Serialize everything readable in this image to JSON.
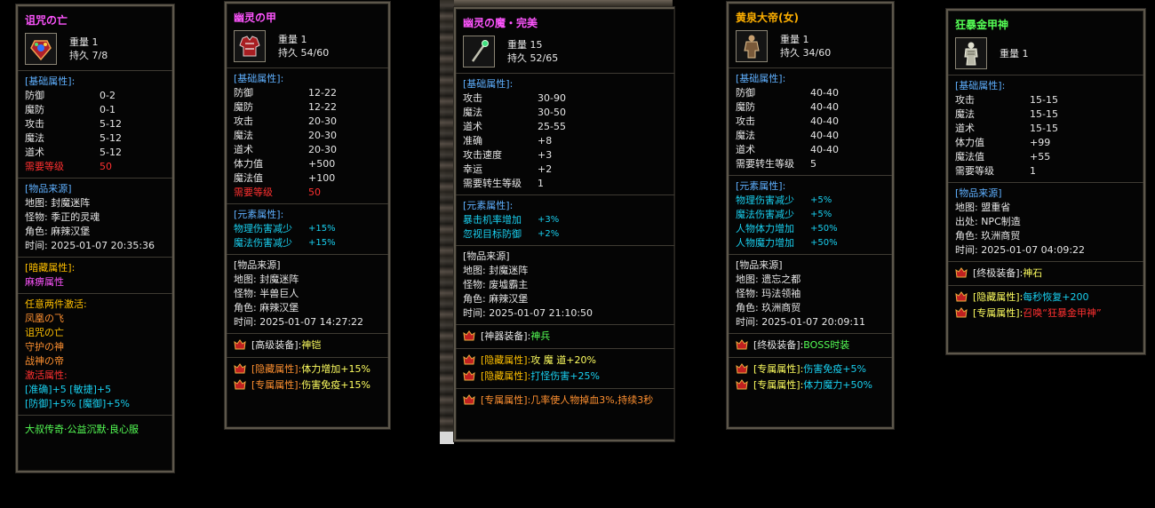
{
  "panels": [
    {
      "title": "诅咒の亡",
      "weight": "重量 1",
      "durability": "持久 7/8",
      "base_label": "[基础属性]:",
      "base": [
        {
          "k": "防御",
          "v": "0-2"
        },
        {
          "k": "魔防",
          "v": "0-1"
        },
        {
          "k": "攻击",
          "v": "5-12"
        },
        {
          "k": "魔法",
          "v": "5-12"
        },
        {
          "k": "道术",
          "v": "5-12"
        }
      ],
      "req": {
        "k": "需要等级",
        "v": "50"
      },
      "source_label": "[物品来源]",
      "source": [
        "地图: 封魔迷阵",
        "怪物: 季正的灵魂",
        "角色: 麻辣汉堡",
        "时间: 2025-01-07 20:35:36"
      ],
      "hidden_label": "[暗藏属性]:",
      "hidden_value": "麻痹属性",
      "set_title": "任意两件激活:",
      "set_items": [
        "凤凰の飞",
        "诅咒の亡",
        "守护の神",
        "战神の帝"
      ],
      "set_active": "激活属性:",
      "set_bonus_1": "[准确]+5  [敏捷]+5",
      "set_bonus_2": "[防御]+5%  [魔御]+5%",
      "footer": "大叔传奇·公益沉默·良心服"
    },
    {
      "title": "幽灵の甲",
      "weight": "重量 1",
      "durability": "持久 54/60",
      "base_label": "[基础属性]:",
      "base": [
        {
          "k": "防御",
          "v": "12-22"
        },
        {
          "k": "魔防",
          "v": "12-22"
        },
        {
          "k": "攻击",
          "v": "20-30"
        },
        {
          "k": "魔法",
          "v": "20-30"
        },
        {
          "k": "道术",
          "v": "20-30"
        },
        {
          "k": "体力值",
          "v": "+500"
        },
        {
          "k": "魔法值",
          "v": "+100"
        }
      ],
      "req": {
        "k": "需要等级",
        "v": "50"
      },
      "elem_label": "[元素属性]:",
      "elem": [
        {
          "k": "物理伤害减少",
          "v": "+15%"
        },
        {
          "k": "魔法伤害减少",
          "v": "+15%"
        }
      ],
      "source_label": "[物品来源]",
      "source": [
        "地图: 封魔迷阵",
        "怪物: 半兽巨人",
        "角色: 麻辣汉堡",
        "时间: 2025-01-07 14:27:22"
      ],
      "equip_label": "[高级装备]:",
      "equip_value": "神铠",
      "hidden_label": "[隐藏属性]:",
      "hidden_value": "体力增加+15%",
      "special_label": "[专属属性]:",
      "special_value": "伤害免疫+15%"
    },
    {
      "title": "幽灵の魔・完美",
      "weight": "重量 15",
      "durability": "持久 52/65",
      "base_label": "[基础属性]:",
      "base": [
        {
          "k": "攻击",
          "v": "30-90"
        },
        {
          "k": "魔法",
          "v": "30-50"
        },
        {
          "k": "道术",
          "v": "25-55"
        },
        {
          "k": "准确",
          "v": "+8"
        },
        {
          "k": "攻击速度",
          "v": "+3"
        },
        {
          "k": "幸运",
          "v": "+2"
        },
        {
          "k": "需要转生等级",
          "v": "1"
        }
      ],
      "elem_label": "[元素属性]:",
      "elem": [
        {
          "k": "暴击机率增加",
          "v": "+3%"
        },
        {
          "k": "忽视目标防御",
          "v": "+2%"
        }
      ],
      "source_label": "[物品来源]",
      "source": [
        "地图: 封魔迷阵",
        "怪物: 废墟霸主",
        "角色: 麻辣汉堡",
        "时间: 2025-01-07 21:10:50"
      ],
      "equip_label": "[神器装备]:",
      "equip_value": "神兵",
      "hidden1_label": "[隐藏属性]:",
      "hidden1_value": "攻 魔 道+20%",
      "hidden2_label": "[隐藏属性]:",
      "hidden2_value": "打怪伤害+25%",
      "special_label": "[专属属性]:",
      "special_value": "几率使人物掉血3%,持续3秒"
    },
    {
      "title": "黄泉大帝(女)",
      "weight": "重量 1",
      "durability": "持久 34/60",
      "base_label": "[基础属性]:",
      "base": [
        {
          "k": "防御",
          "v": "40-40"
        },
        {
          "k": "魔防",
          "v": "40-40"
        },
        {
          "k": "攻击",
          "v": "40-40"
        },
        {
          "k": "魔法",
          "v": "40-40"
        },
        {
          "k": "道术",
          "v": "40-40"
        },
        {
          "k": "需要转生等级",
          "v": "5"
        }
      ],
      "elem_label": "[元素属性]:",
      "elem": [
        {
          "k": "物理伤害减少",
          "v": "+5%"
        },
        {
          "k": "魔法伤害减少",
          "v": "+5%"
        },
        {
          "k": "人物体力增加",
          "v": "+50%"
        },
        {
          "k": "人物魔力增加",
          "v": "+50%"
        }
      ],
      "source_label": "[物品来源]",
      "source": [
        "地图: 遗忘之都",
        "怪物: 玛法领袖",
        "角色: 玖洲商贸",
        "时间: 2025-01-07 20:09:11"
      ],
      "equip_label": "[终极装备]:",
      "equip_value": "BOSS时装",
      "special1_label": "[专属属性]:",
      "special1_value": "伤害免疫+5%",
      "special2_label": "[专属属性]:",
      "special2_value": "体力魔力+50%"
    },
    {
      "title": "狂暴金甲神",
      "weight": "重量 1",
      "base_label": "[基础属性]:",
      "base": [
        {
          "k": "攻击",
          "v": "15-15"
        },
        {
          "k": "魔法",
          "v": "15-15"
        },
        {
          "k": "道术",
          "v": "15-15"
        },
        {
          "k": "体力值",
          "v": "+99"
        },
        {
          "k": "魔法值",
          "v": "+55"
        },
        {
          "k": "需要等级",
          "v": "1"
        }
      ],
      "source_label": "[物品来源]",
      "source": [
        "地图: 盟重省",
        "出处: NPC制造",
        "角色: 玖洲商贸",
        "时间: 2025-01-07 04:09:22"
      ],
      "equip_label": "[终极装备]:",
      "equip_value": "神石",
      "hidden_label": "[隐藏属性]:",
      "hidden_value": "每秒恢复+200",
      "special_label": "[专属属性]:",
      "special_value": "召唤“狂暴金甲神”"
    }
  ]
}
